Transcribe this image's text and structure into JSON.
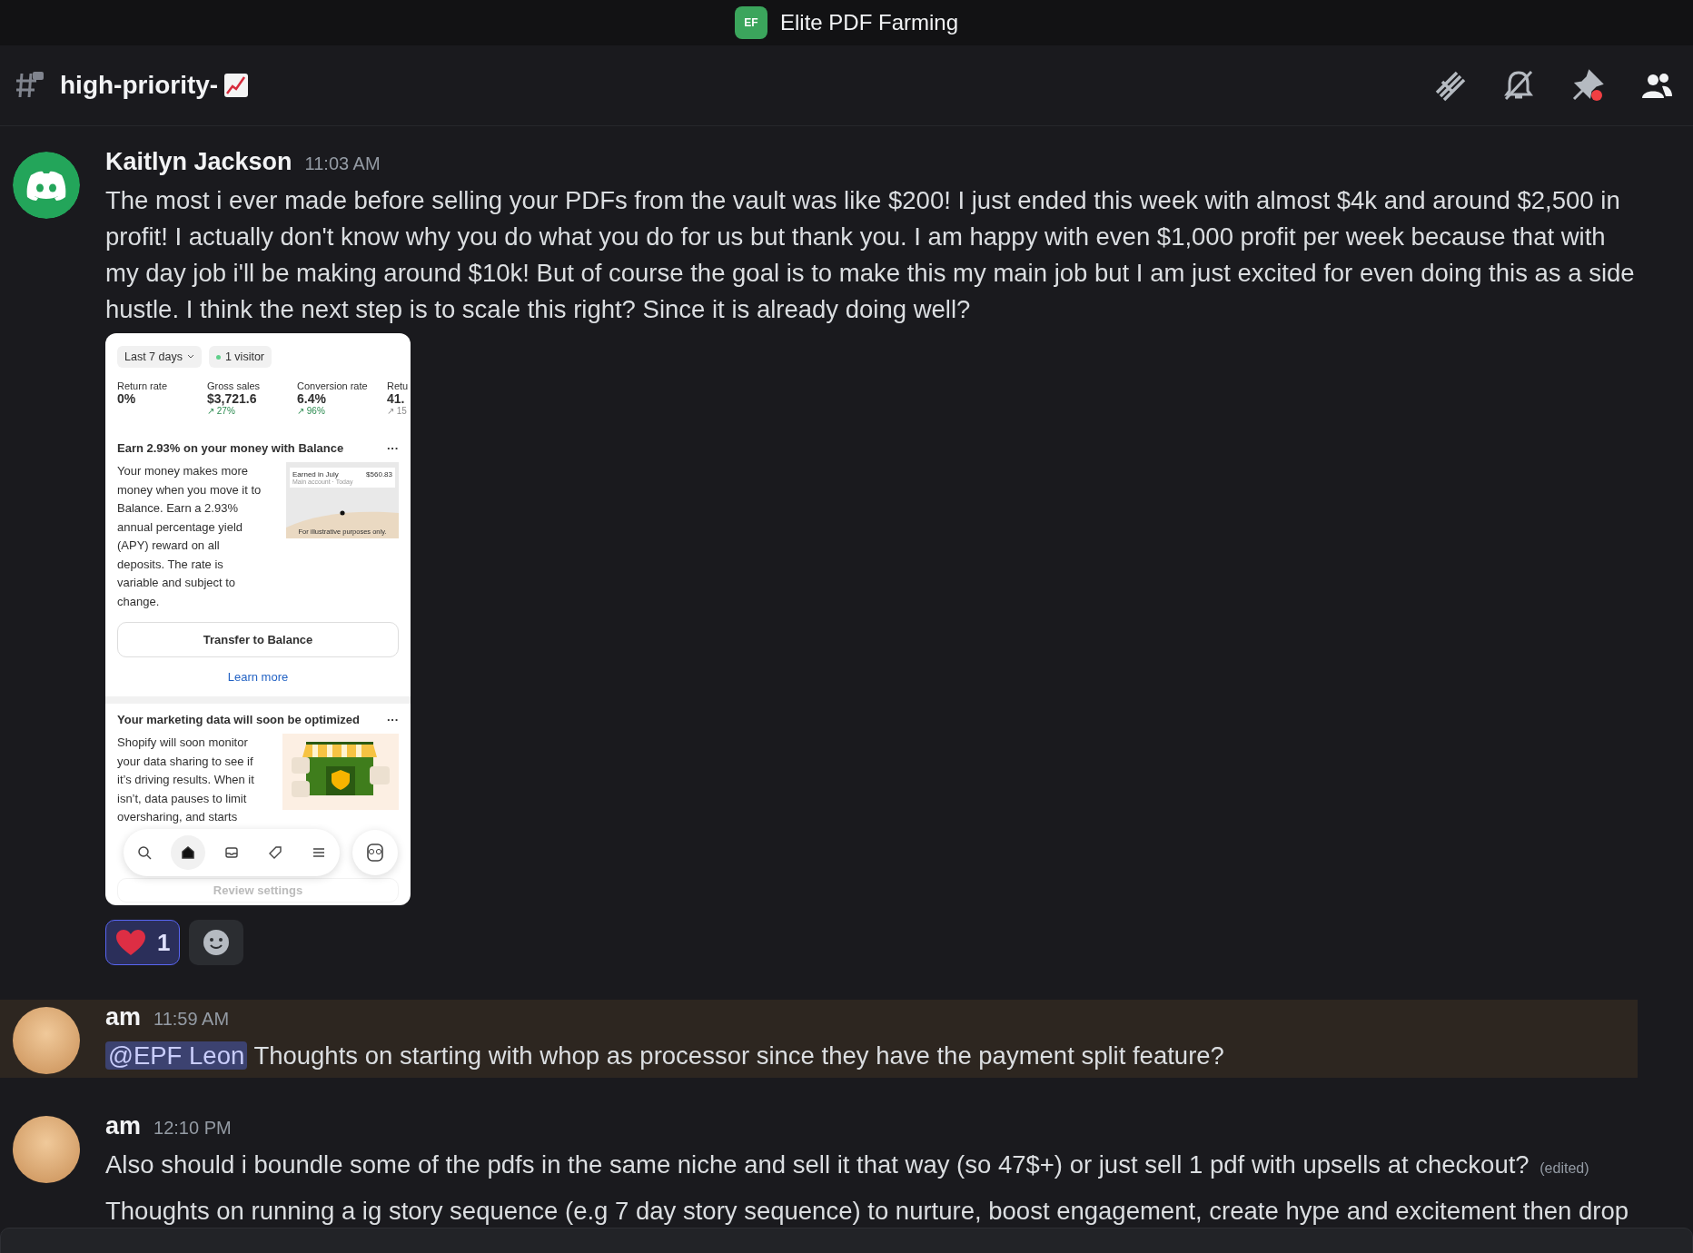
{
  "server": {
    "name": "Elite PDF Farming",
    "icon_text": "EF"
  },
  "channel": {
    "name": "high-priority-"
  },
  "messages": [
    {
      "author": "Kaitlyn Jackson",
      "time": "11:03 AM",
      "kind": "logo",
      "highlighted": false,
      "paragraphs": [
        "The most i ever made before selling your PDFs from the vault was like $200! I just ended this week with almost $4k and around $2,500 in profit! I actually don't know why you do what you do for us but thank you. I am happy with even $1,000 profit per week because that with my day job i'll be making around $10k! But of course the goal is to make this my main job but I am just excited for even doing this as a side hustle. I think the next step is to scale this right? Since it is already doing well?"
      ],
      "attachment": {
        "date_filter": "Last 7 days",
        "visitors": "1 visitor",
        "metrics": [
          {
            "label": "Return rate",
            "value": "0%"
          },
          {
            "label": "Gross sales",
            "value": "$3,721.6",
            "change": "↗ 27%"
          },
          {
            "label": "Conversion rate",
            "value": "6.4%",
            "change": "↗ 96%"
          },
          {
            "label": "Retu",
            "value": "41.",
            "change": "↗ 15"
          }
        ],
        "cards": [
          {
            "kind": "balance",
            "title": "Earn 2.93% on your money with Balance",
            "menu": "···",
            "body": "Your money makes more money when you move it to Balance. Earn a 2.93% annual percentage yield (APY) reward on all deposits. The rate is variable and subject to change.",
            "illustration": {
              "label": "Earned in July",
              "sublabel": "Main account · Today",
              "amount": "$560.83",
              "note": "For illustrative purposes only."
            },
            "button": "Transfer to Balance",
            "link": "Learn more"
          },
          {
            "kind": "marketing",
            "title": "Your marketing data will soon be optimized",
            "menu": "···",
            "body": "Shopify will soon monitor your data sharing to see if it’s driving results. When it isn’t, data pauses to limit oversharing, and starts",
            "button": "Review settings"
          }
        ],
        "nav": [
          {
            "kind": "search",
            "selected": false
          },
          {
            "kind": "home",
            "selected": true
          },
          {
            "kind": "inbox",
            "selected": false
          },
          {
            "kind": "tag",
            "selected": false
          },
          {
            "kind": "menu",
            "selected": false
          }
        ]
      },
      "reactions": [
        {
          "kind": "heart",
          "count": "1",
          "selected": true
        }
      ]
    },
    {
      "author": "am",
      "time": "11:59 AM",
      "kind": "photo",
      "highlighted": true,
      "mention": "@EPF Leon",
      "paragraphs": [
        "Thoughts on starting with whop as processor since they have the payment split feature?"
      ]
    },
    {
      "author": "am",
      "time": "12:10 PM",
      "kind": "photo",
      "highlighted": false,
      "paragraphs": [
        "Also should i boundle some of the pdfs in the same niche and sell it that way (so 47$+) or just sell 1 pdf with upsells at checkout?",
        "Thoughts on running a ig story sequence (e.g 7 day story sequence) to nurture, boost engagement, create hype and excitement then drop"
      ],
      "edited": "(edited)"
    }
  ]
}
